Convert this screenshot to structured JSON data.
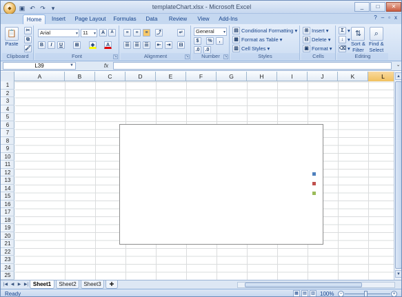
{
  "window": {
    "title": "templateChart.xlsx - Microsoft Excel",
    "office_button": "Office",
    "qat": [
      "save-icon",
      "undo-icon",
      "redo-icon",
      "customize-icon"
    ],
    "controls": [
      "_",
      "□",
      "✕"
    ]
  },
  "ribbon": {
    "tabs": [
      {
        "label": "Home",
        "active": true
      },
      {
        "label": "Insert"
      },
      {
        "label": "Page Layout"
      },
      {
        "label": "Formulas"
      },
      {
        "label": "Data"
      },
      {
        "label": "Review"
      },
      {
        "label": "View"
      },
      {
        "label": "Add-Ins"
      }
    ],
    "help": "?",
    "groups": {
      "clipboard": {
        "label": "Clipboard",
        "paste": "Paste"
      },
      "font": {
        "label": "Font",
        "name": "Arial",
        "size": "11",
        "bold": "B",
        "italic": "I",
        "underline": "U"
      },
      "alignment": {
        "label": "Alignment"
      },
      "number": {
        "label": "Number",
        "format": "General",
        "percent": "%",
        "comma": ","
      },
      "styles": {
        "label": "Styles",
        "conditional": "Conditional Formatting",
        "table": "Format as Table",
        "cell_styles": "Cell Styles"
      },
      "cells": {
        "label": "Cells",
        "insert": "Insert",
        "delete": "Delete",
        "format": "Format"
      },
      "editing": {
        "label": "Editing",
        "sort": "Sort &",
        "sort2": "Filter",
        "find": "Find &",
        "find2": "Select",
        "sum": "Σ"
      }
    }
  },
  "formula_bar": {
    "name_box": "L39",
    "fx": "fx",
    "value": ""
  },
  "grid": {
    "columns": [
      "A",
      "B",
      "C",
      "D",
      "E",
      "F",
      "G",
      "H",
      "I",
      "J",
      "K",
      "L"
    ],
    "selected_column": "L",
    "rows": [
      "1",
      "2",
      "3",
      "4",
      "5",
      "6",
      "7",
      "8",
      "9",
      "10",
      "11",
      "12",
      "13",
      "14",
      "15",
      "16",
      "17",
      "18",
      "19",
      "20",
      "21",
      "22",
      "23",
      "24",
      "25"
    ]
  },
  "chart": {
    "legend_colors": [
      "#4f81bd",
      "#c0504d",
      "#9bbb59"
    ]
  },
  "sheets": [
    {
      "label": "Sheet1",
      "active": true
    },
    {
      "label": "Sheet2"
    },
    {
      "label": "Sheet3"
    }
  ],
  "status": {
    "ready": "Ready",
    "zoom": "100%",
    "zoom_minus": "−",
    "zoom_plus": "+"
  }
}
